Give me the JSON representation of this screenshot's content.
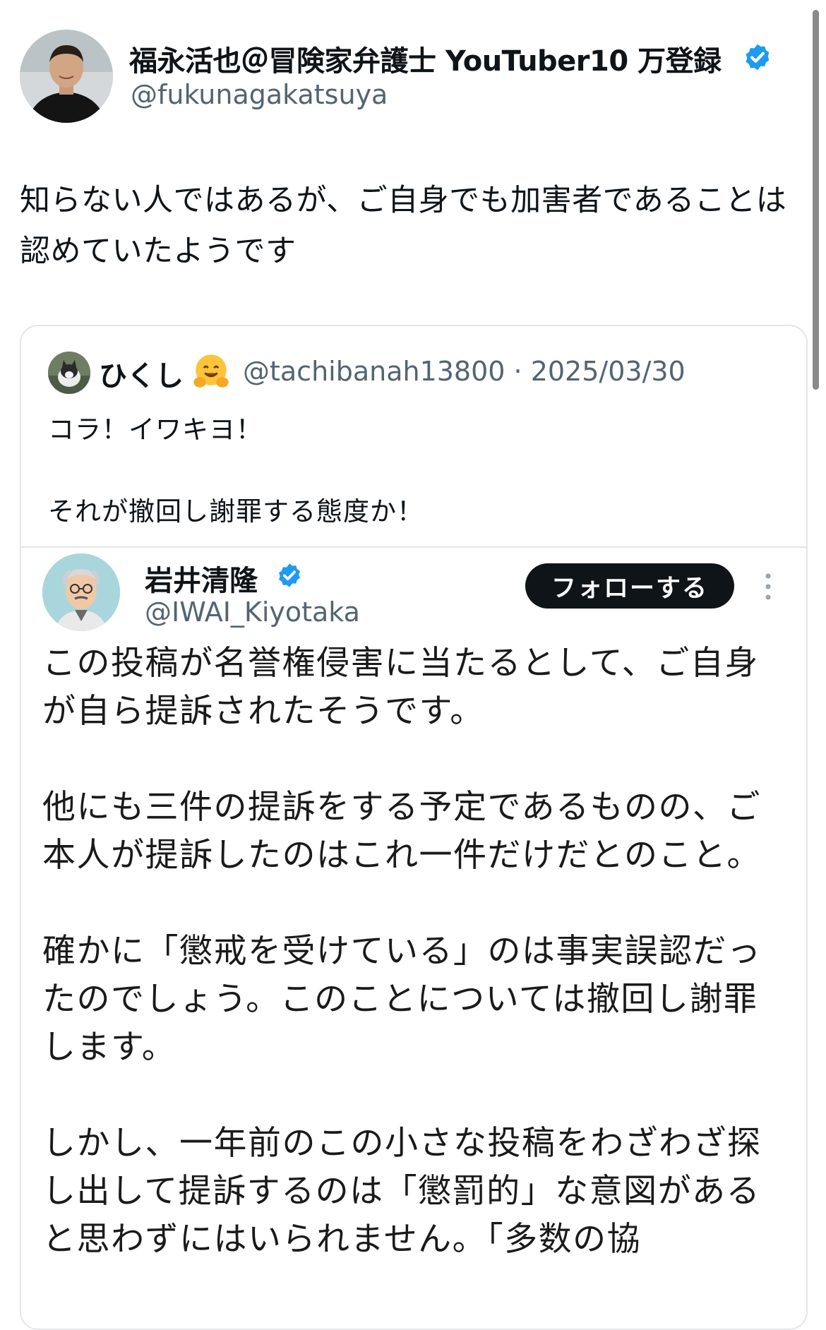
{
  "post": {
    "author_name": "福永活也＠冒険家弁護士 YouTuber10 万登録",
    "author_handle": "@fukunagakatsuya",
    "text": "知らない人ではあるが、ご自身でも加害者であることは認めていたようです"
  },
  "quoted_post": {
    "author_name": "ひくし",
    "author_emoji": "hugging-face-emoji",
    "meta": "@tachibanah13800 · 2025/03/30",
    "text": "コラ！イワキヨ！\n\nそれが撤回し謝罪する態度か！"
  },
  "embedded": {
    "author_name": "岩井清隆",
    "author_handle": "@IWAI_Kiyotaka",
    "follow_label": "フォローする",
    "paragraphs": [
      "この投稿が名誉権侵害に当たるとして、ご自身が自ら提訴されたそうです。",
      "他にも三件の提訴をする予定であるものの、ご本人が提訴したのはこれ一件だけだとのこと。",
      "確かに「懲戒を受けている」のは事実誤認だったのでしょう。このことについては撤回し謝罪します。",
      "しかし、一年前のこの小さな投稿をわざわざ探し出して提訴するのは「懲罰的」な意図があると思わずにはいられません。「多数の協"
    ]
  },
  "colors": {
    "verified": "#1d9bf0",
    "handle": "#536471",
    "text": "#0f1419"
  }
}
